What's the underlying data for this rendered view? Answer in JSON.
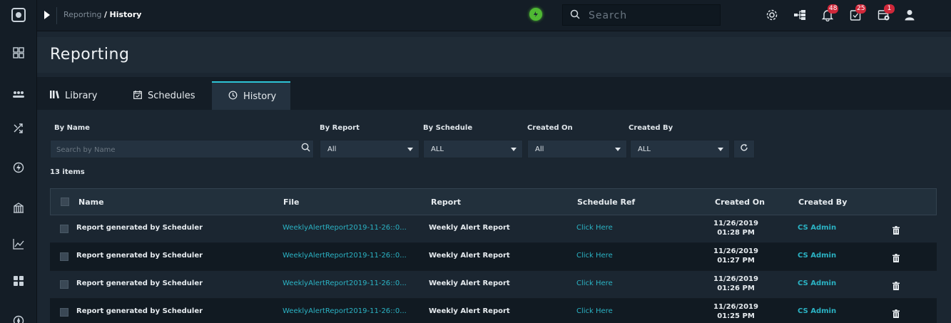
{
  "breadcrumb": {
    "parent": "Reporting",
    "separator": "/",
    "current": "History"
  },
  "search": {
    "placeholder": "Search"
  },
  "header_icons": [
    {
      "name": "gear-icon"
    },
    {
      "name": "network-icon"
    },
    {
      "name": "bell-icon",
      "badge": "48"
    },
    {
      "name": "tasks-icon",
      "badge": "25"
    },
    {
      "name": "calendar-gear-icon",
      "badge": "1"
    },
    {
      "name": "user-icon"
    }
  ],
  "page": {
    "title": "Reporting"
  },
  "tabs": [
    {
      "label": "Library",
      "icon": "library-icon"
    },
    {
      "label": "Schedules",
      "icon": "calendar-icon"
    },
    {
      "label": "History",
      "icon": "history-icon",
      "active": true
    }
  ],
  "filters": {
    "by_name": {
      "label": "By Name",
      "placeholder": "Search by Name"
    },
    "by_report": {
      "label": "By Report",
      "value": "All"
    },
    "by_schedule": {
      "label": "By Schedule",
      "value": "ALL"
    },
    "created_on": {
      "label": "Created On",
      "value": "All"
    },
    "created_by": {
      "label": "Created By",
      "value": "ALL"
    }
  },
  "count": "13 items",
  "table": {
    "headers": {
      "name": "Name",
      "file": "File",
      "report": "Report",
      "schedule_ref": "Schedule Ref",
      "created_on": "Created On",
      "created_by": "Created By"
    },
    "rows": [
      {
        "name": "Report generated by Scheduler",
        "file": "WeeklyAlertReport2019-11-26::0...",
        "report": "Weekly Alert Report",
        "schedule_ref": "Click Here",
        "date": "11/26/2019",
        "time": "01:28 PM",
        "created_by": "CS Admin"
      },
      {
        "name": "Report generated by Scheduler",
        "file": "WeeklyAlertReport2019-11-26::0...",
        "report": "Weekly Alert Report",
        "schedule_ref": "Click Here",
        "date": "11/26/2019",
        "time": "01:27 PM",
        "created_by": "CS Admin"
      },
      {
        "name": "Report generated by Scheduler",
        "file": "WeeklyAlertReport2019-11-26::0...",
        "report": "Weekly Alert Report",
        "schedule_ref": "Click Here",
        "date": "11/26/2019",
        "time": "01:26 PM",
        "created_by": "CS Admin"
      },
      {
        "name": "Report generated by Scheduler",
        "file": "WeeklyAlertReport2019-11-26::0...",
        "report": "Weekly Alert Report",
        "schedule_ref": "Click Here",
        "date": "11/26/2019",
        "time": "01:25 PM",
        "created_by": "CS Admin"
      }
    ]
  },
  "colors": {
    "accent": "#2ec4d6",
    "link": "#2bb3c4",
    "badge": "#d0283a",
    "status": "#4fb833"
  }
}
